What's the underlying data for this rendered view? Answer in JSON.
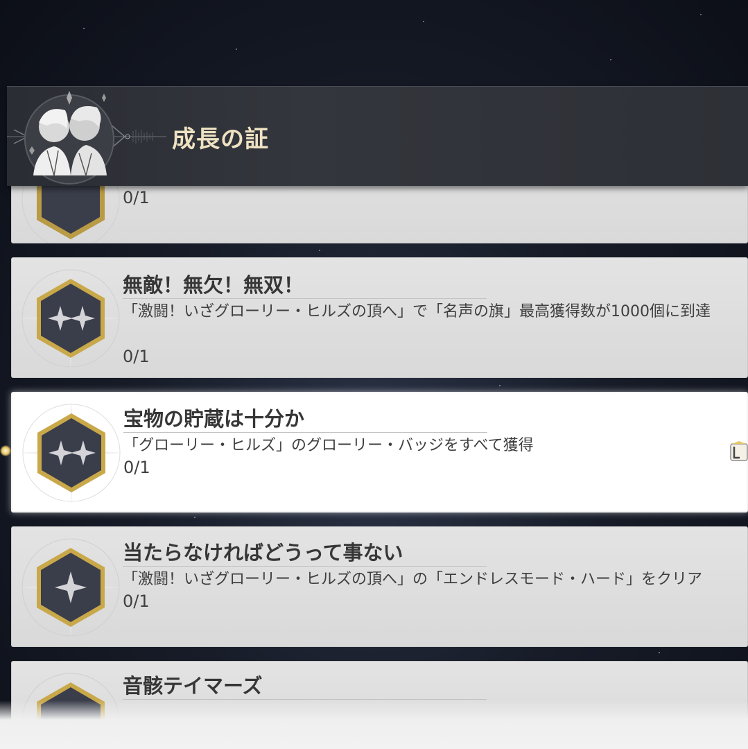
{
  "header": {
    "title": "成長の証",
    "emblem_icon": "twin-characters-emblem-icon"
  },
  "achievements": [
    {
      "title": "",
      "description": "",
      "progress": "0/1",
      "badge_icon": "hexagon-sparkle-badge-icon"
    },
    {
      "title": "無敵！無欠！無双！",
      "description": "「激闘！いざグローリー・ヒルズの頂へ」で「名声の旗」最高獲得数が1000個に到達",
      "progress": "0/1",
      "badge_icon": "hexagon-double-sparkle-badge-icon"
    },
    {
      "title": "宝物の貯蔵は十分か",
      "description": "「グローリー・ヒルズ」のグローリー・バッジをすべて獲得",
      "progress": "0/1",
      "badge_icon": "hexagon-double-sparkle-badge-icon"
    },
    {
      "title": "当たらなければどうって事ない",
      "description": "「激闘！いざグローリー・ヒルズの頂へ」の「エンドレスモード・ハード」をクリア",
      "progress": "0/1",
      "badge_icon": "hexagon-single-sparkle-badge-icon"
    },
    {
      "title": "音骸テイマーズ",
      "description": "",
      "progress": "",
      "badge_icon": "hexagon-sparkle-badge-icon"
    }
  ],
  "colors": {
    "header_bg": "#2f3238",
    "header_title": "#efe2c2",
    "card_bg": "#dedede",
    "card_selected_bg": "#ffffff",
    "badge_gold": "#c9a84a",
    "badge_fill": "#3a3d4a"
  }
}
